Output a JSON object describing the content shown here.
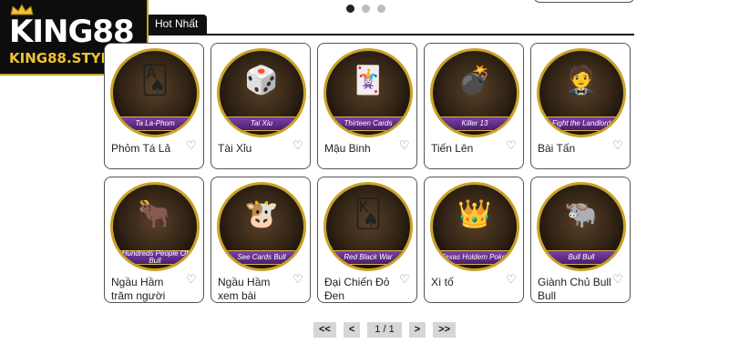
{
  "brand": {
    "name": "KING88",
    "domain": "KING88.STYLE",
    "accent": "#c9a227"
  },
  "carousel": {
    "dots": 3,
    "active_index": 0
  },
  "tabs": {
    "active_label": "Hot Nhất"
  },
  "games": [
    {
      "title": "Phỏm Tá Lả",
      "banner": "Ta La-Phom",
      "icon": "phom-cards-icon",
      "glyph": "🂡"
    },
    {
      "title": "Tài Xỉu",
      "banner": "Tai Xiu",
      "icon": "dice-cup-icon",
      "glyph": "🎲"
    },
    {
      "title": "Mậu Binh",
      "banner": "Thirteen Cards",
      "icon": "revolver-cards-icon",
      "glyph": "🃏"
    },
    {
      "title": "Tiến Lên",
      "banner": "Killer 13",
      "icon": "bomb-cards-icon",
      "glyph": "💣"
    },
    {
      "title": "Bài Tấn",
      "banner": "Fight the Landlord",
      "icon": "landlord-character-icon",
      "glyph": "🤵"
    },
    {
      "title": "Ngầu Hầm trăm người",
      "banner": "Hundreds People Of Bull",
      "icon": "bull-chips-icon",
      "glyph": "🐂"
    },
    {
      "title": "Ngầu Hầm xem bài",
      "banner": "See Cards Bull",
      "icon": "cartoon-bull-icon",
      "glyph": "🐮"
    },
    {
      "title": "Đại Chiến Đỏ Đen",
      "banner": "Red Black War",
      "icon": "vs-cards-icon",
      "glyph": "🂮"
    },
    {
      "title": "Xì tố",
      "banner": "Texas Holdem Poker",
      "icon": "crown-cards-icon",
      "glyph": "👑"
    },
    {
      "title": "Giành Chủ Bull Bull",
      "banner": "Bull Bull",
      "icon": "golden-bull-icon",
      "glyph": "🐃"
    }
  ],
  "pagination": {
    "first": "<<",
    "prev": "<",
    "info": "1 / 1",
    "next": ">",
    "last": ">>"
  }
}
